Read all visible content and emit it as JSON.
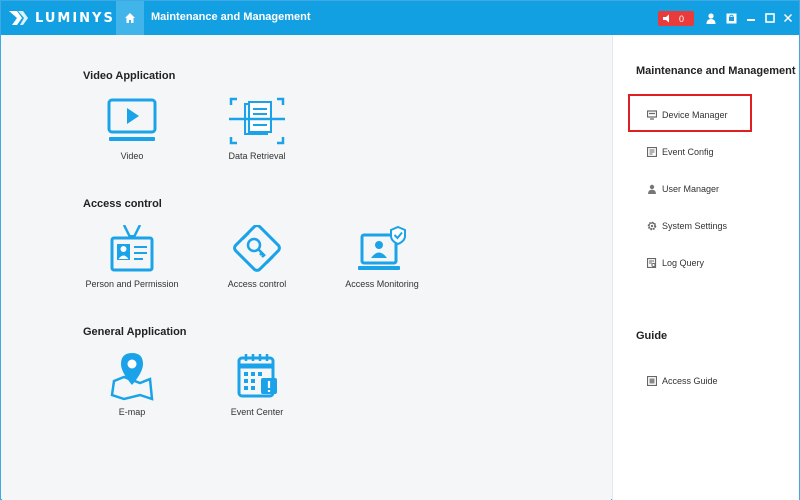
{
  "app": {
    "brand": "LUMINYS",
    "tab_title": "Maintenance and Management",
    "alarm_count": "0"
  },
  "colors": {
    "titlebar": "#12a0e3",
    "icon_blue": "#1aa3e8",
    "alarm_red": "#e93b3b",
    "highlight": "#e02020"
  },
  "titlebar_icons": [
    "home-icon",
    "alarm-icon",
    "user-icon",
    "lock-icon",
    "minimize-icon",
    "maximize-icon",
    "close-icon"
  ],
  "sections": {
    "video": {
      "title": "Video Application",
      "apps": [
        "Video",
        "Data Retrieval"
      ]
    },
    "access": {
      "title": "Access control",
      "apps": [
        "Person and Permission",
        "Access control",
        "Access Monitoring"
      ]
    },
    "general": {
      "title": "General Application",
      "apps": [
        "E-map",
        "Event Center"
      ]
    }
  },
  "right_panel": {
    "maintenance_title": "Maintenance and Management",
    "items": [
      "Device Manager",
      "Event Config",
      "User Manager",
      "System Settings",
      "Log Query"
    ],
    "guide_title": "Guide",
    "guide_items": [
      "Access Guide"
    ]
  }
}
